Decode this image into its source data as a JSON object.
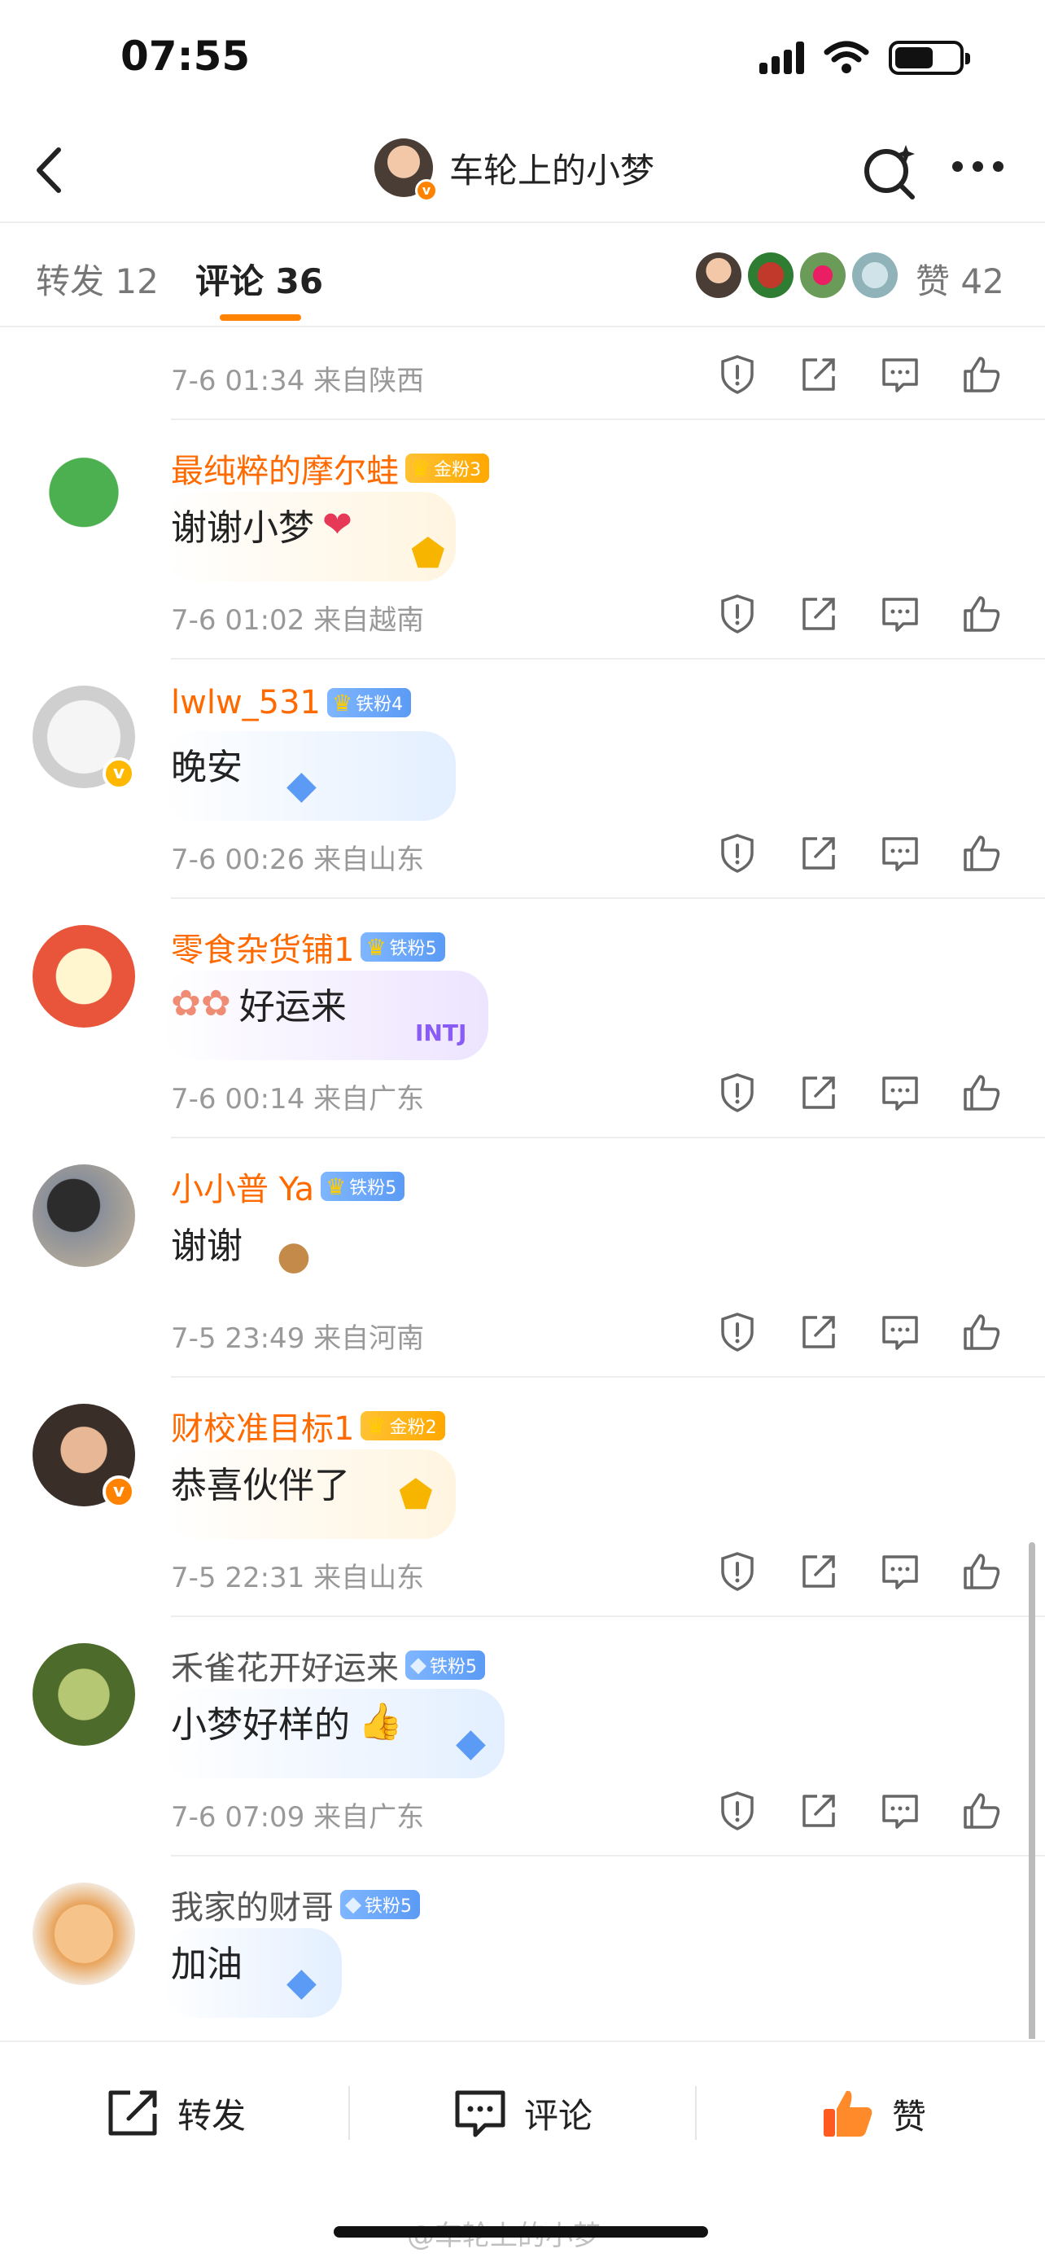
{
  "status_bar": {
    "time": "07:55"
  },
  "header": {
    "title": "车轮上的小梦"
  },
  "tabs": {
    "repost": "转发 12",
    "comment": "评论 36",
    "likes": "赞 42"
  },
  "top_partial": {
    "meta": "7-6 01:34  来自陕西"
  },
  "comments": [
    {
      "name": "最纯粹的摩尔蛙",
      "badge": "金粉3",
      "badge_type": "gold",
      "text": "谢谢小梦",
      "meta": "7-6 01:02  来自越南"
    },
    {
      "name": "lwlw_531",
      "badge": "铁粉4",
      "badge_type": "iron",
      "text": "晚安",
      "meta": "7-6 00:26  来自山东"
    },
    {
      "name": "零食杂货铺1",
      "badge": "铁粉5",
      "badge_type": "iron",
      "text": "好运来",
      "meta": "7-6 00:14  来自广东"
    },
    {
      "name": "小小普 Ya",
      "badge": "铁粉5",
      "badge_type": "iron",
      "text": "谢谢",
      "meta": "7-5 23:49  来自河南"
    },
    {
      "name": "财校准目标1",
      "badge": "金粉2",
      "badge_type": "gold",
      "text": "恭喜伙伴了",
      "meta": "7-5 22:31  来自山东"
    },
    {
      "name": "禾雀花开好运来",
      "badge": "铁粉5",
      "badge_type": "iron",
      "text": "小梦好样的",
      "meta": "7-6 07:09  来自广东"
    },
    {
      "name": "我家的财哥",
      "badge": "铁粉5",
      "badge_type": "iron",
      "text": "加油",
      "meta": ""
    }
  ],
  "bottom_bar": {
    "repost": "转发",
    "comment": "评论",
    "like": "赞"
  },
  "watermark": "@车轮上的小梦",
  "colors": {
    "accent": "#ff8200",
    "username": "#ff6a00",
    "meta": "#999999"
  }
}
